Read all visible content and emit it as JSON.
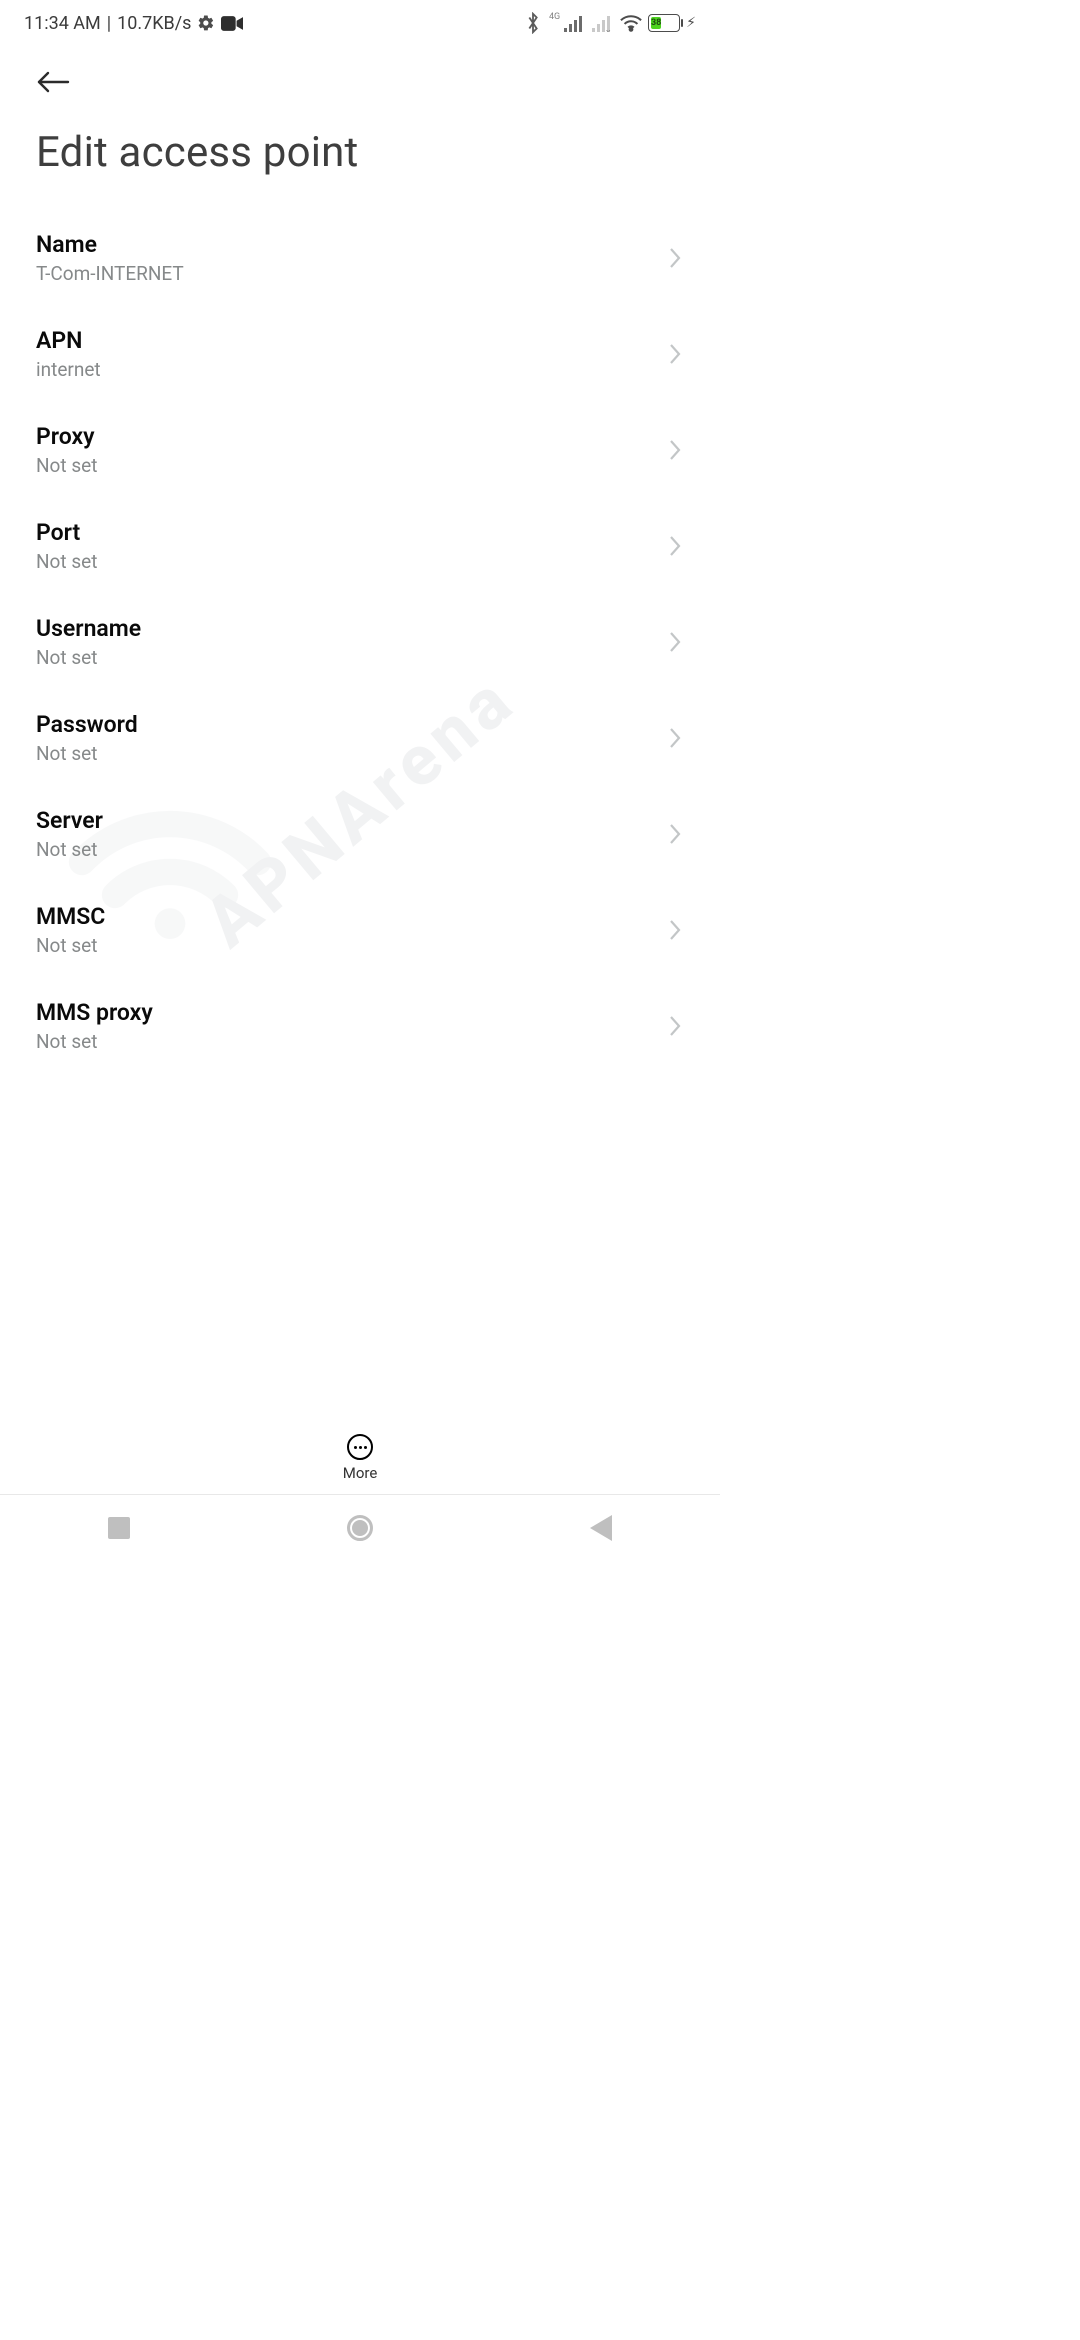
{
  "status": {
    "time": "11:34 AM",
    "net_speed": "10.7KB/s",
    "net_label": "4G",
    "battery_percent": "38"
  },
  "page": {
    "title": "Edit access point"
  },
  "rows": [
    {
      "label": "Name",
      "value": "T-Com-INTERNET"
    },
    {
      "label": "APN",
      "value": "internet"
    },
    {
      "label": "Proxy",
      "value": "Not set"
    },
    {
      "label": "Port",
      "value": "Not set"
    },
    {
      "label": "Username",
      "value": "Not set"
    },
    {
      "label": "Password",
      "value": "Not set"
    },
    {
      "label": "Server",
      "value": "Not set"
    },
    {
      "label": "MMSC",
      "value": "Not set"
    },
    {
      "label": "MMS proxy",
      "value": "Not set"
    }
  ],
  "more_label": "More",
  "watermark": "APNArena"
}
